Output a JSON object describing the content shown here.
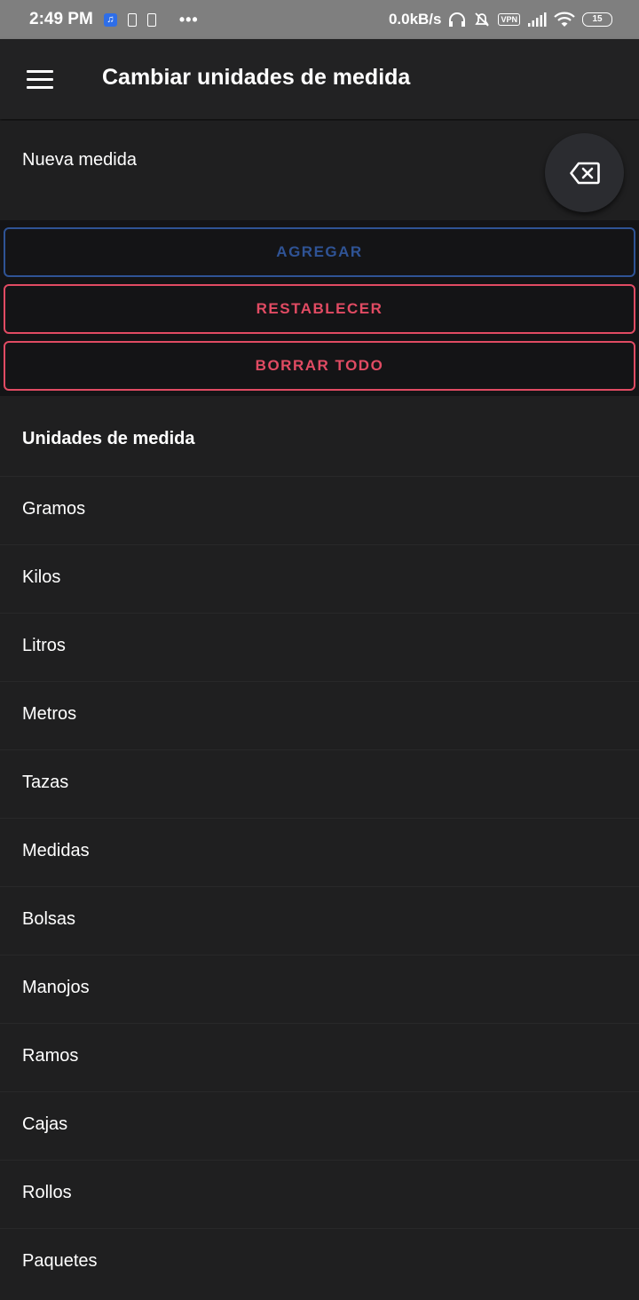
{
  "status_bar": {
    "time": "2:49 PM",
    "speed": "0.0kB/s",
    "vpn": "VPN",
    "battery": "15",
    "icons": [
      "music-icon",
      "document-icon",
      "document-icon",
      "more-dots-icon",
      "headphones-icon",
      "alarm-off-icon",
      "vpn-icon",
      "signal-icon",
      "wifi-icon",
      "battery-icon"
    ]
  },
  "app_bar": {
    "title": "Cambiar unidades de medida",
    "menu_icon": "hamburger-menu-icon"
  },
  "input": {
    "placeholder": "Nueva medida",
    "value": "",
    "clear_icon": "backspace-icon"
  },
  "buttons": {
    "add_label": "AGREGAR",
    "reset_label": "RESTABLECER",
    "clear_label": "BORRAR TODO"
  },
  "colors": {
    "add_accent": "#2f5395",
    "danger_accent": "#e14b63",
    "background": "#1f1f20",
    "buttons_background": "#141416"
  },
  "list": {
    "header": "Unidades de medida",
    "items": [
      "Gramos",
      "Kilos",
      "Litros",
      "Metros",
      "Tazas",
      "Medidas",
      "Bolsas",
      "Manojos",
      "Ramos",
      "Cajas",
      "Rollos",
      "Paquetes"
    ]
  }
}
